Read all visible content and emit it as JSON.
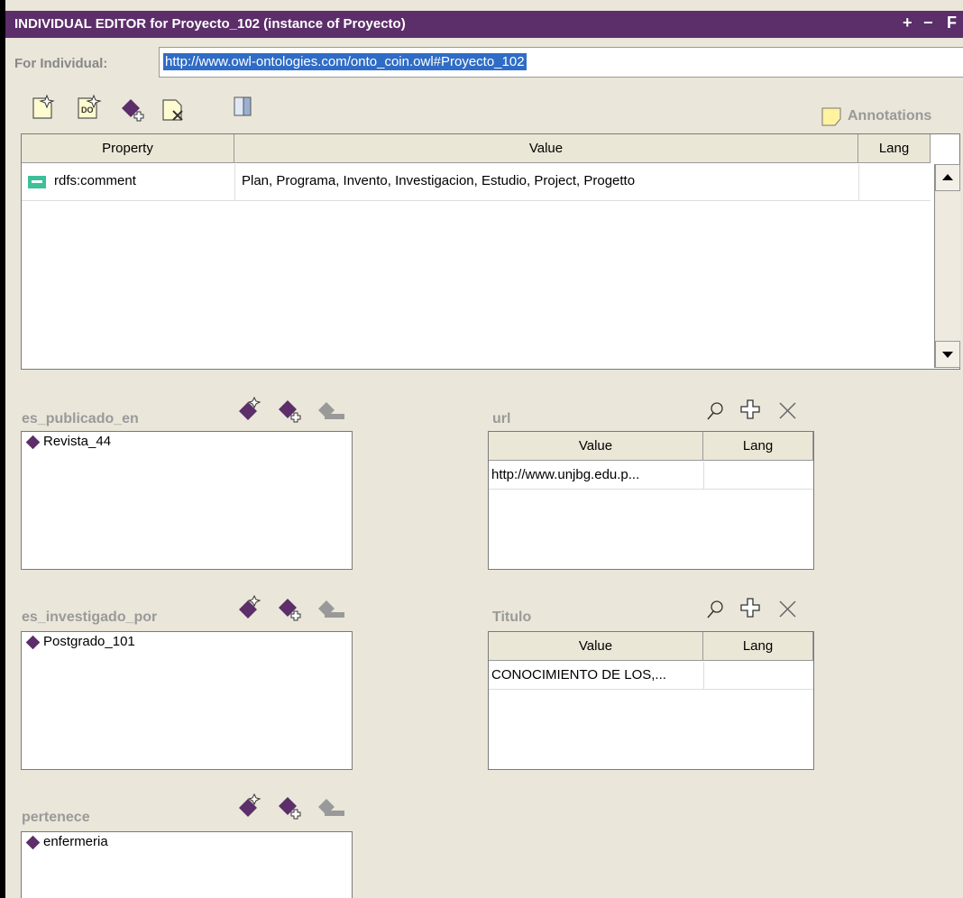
{
  "window": {
    "title": "INDIVIDUAL EDITOR for Proyecto_102   (instance of Proyecto)",
    "controls": [
      "+",
      "−",
      "F"
    ]
  },
  "individual": {
    "label": "For Individual:",
    "uri": "http://www.owl-ontologies.com/onto_coin.owl#Proyecto_102"
  },
  "toolbar": {
    "icons": [
      "create-resource-icon",
      "create-datatype-icon",
      "add-instance-icon",
      "remove-value-icon",
      "columns-icon"
    ],
    "annotations_label": "Annotations"
  },
  "annotations_table": {
    "headers": [
      "Property",
      "Value",
      "Lang"
    ],
    "rows": [
      {
        "property": "rdfs:comment",
        "value": "Plan, Programa, Invento, Investigacion, Estudio, Project, Progetto",
        "lang": ""
      }
    ]
  },
  "sections": {
    "es_publicado_en": {
      "label": "es_publicado_en",
      "items": [
        "Revista_44"
      ]
    },
    "es_investigado_por": {
      "label": "es_investigado_por",
      "items": [
        "Postgrado_101"
      ]
    },
    "pertenece": {
      "label": "pertenece",
      "items": [
        "enfermeria"
      ]
    },
    "url": {
      "label": "url",
      "headers": [
        "Value",
        "Lang"
      ],
      "rows": [
        {
          "value": "http://www.unjbg.edu.p...",
          "lang": ""
        }
      ]
    },
    "titulo": {
      "label": "Titulo",
      "headers": [
        "Value",
        "Lang"
      ],
      "rows": [
        {
          "value": "CONOCIMIENTO DE LOS,...",
          "lang": ""
        }
      ]
    }
  },
  "colors": {
    "accent": "#5c2e6a",
    "selection": "#2f6cc6",
    "panel": "#eae6d9"
  }
}
